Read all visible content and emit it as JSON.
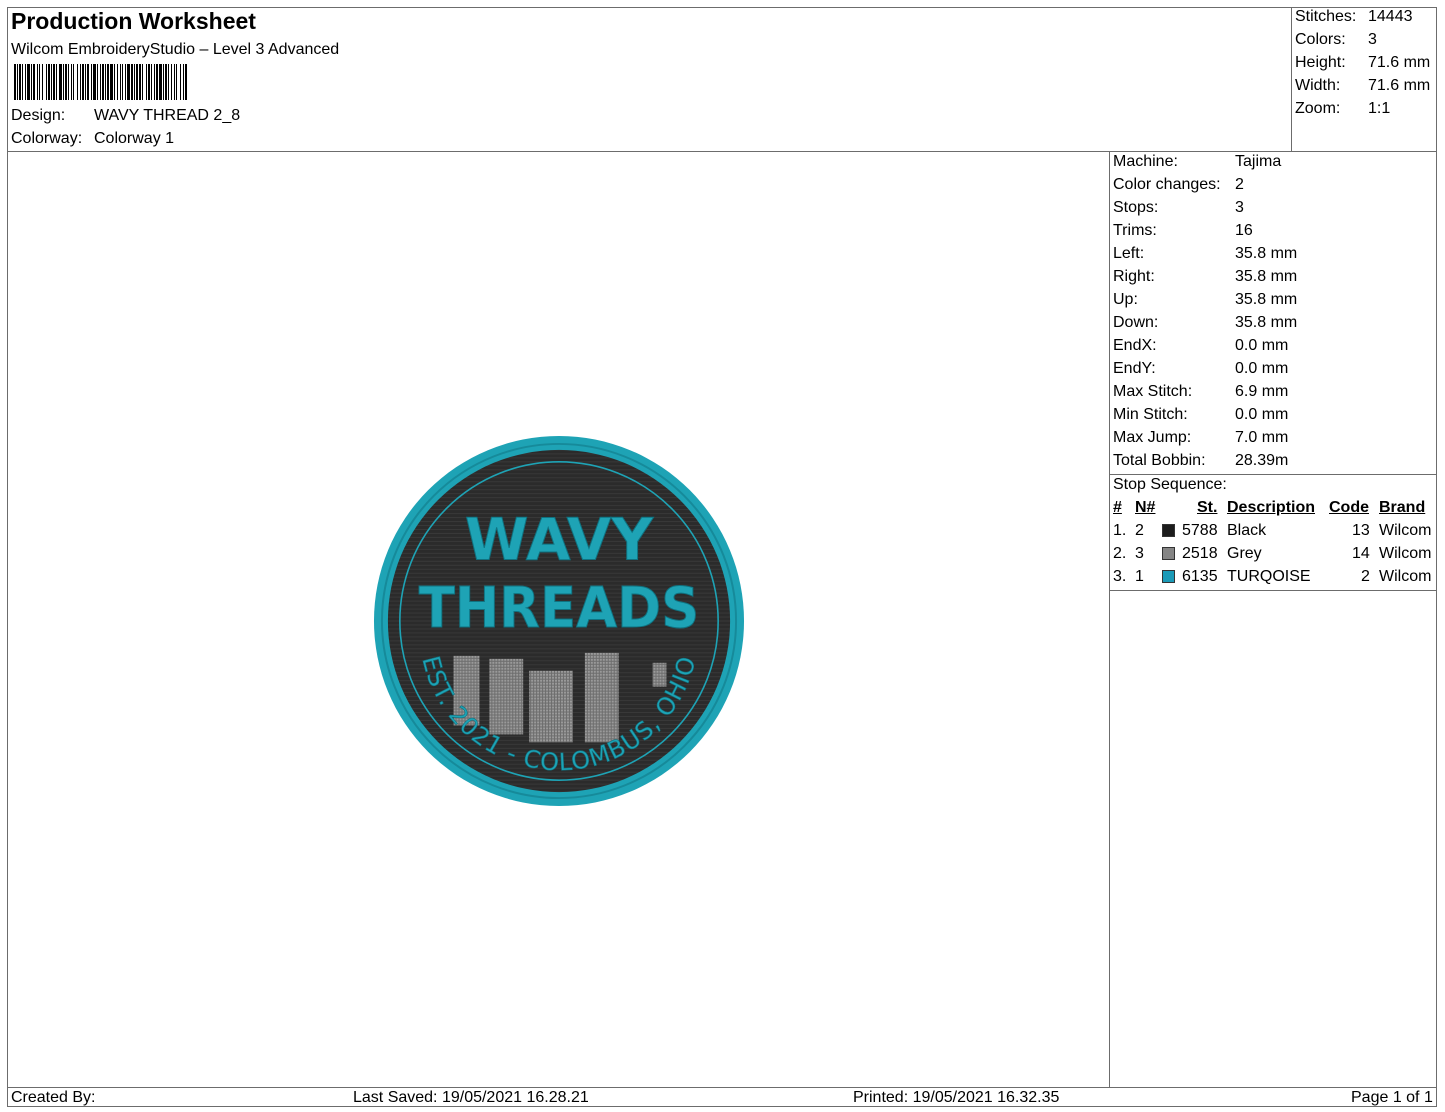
{
  "header": {
    "title": "Production Worksheet",
    "software": "Wilcom EmbroideryStudio – Level 3 Advanced",
    "design_label": "Design:",
    "design_value": "WAVY THREAD 2_8",
    "colorway_label": "Colorway:",
    "colorway_value": "Colorway 1"
  },
  "summary": {
    "stitches_label": "Stitches:",
    "stitches_value": "14443",
    "colors_label": "Colors:",
    "colors_value": "3",
    "height_label": "Height:",
    "height_value": "71.6 mm",
    "width_label": "Width:",
    "width_value": "71.6 mm",
    "zoom_label": "Zoom:",
    "zoom_value": "1:1"
  },
  "properties": [
    {
      "label": "Machine:",
      "value": "Tajima"
    },
    {
      "label": "Color changes:",
      "value": "2"
    },
    {
      "label": "Stops:",
      "value": "3"
    },
    {
      "label": "Trims:",
      "value": "16"
    },
    {
      "label": "Left:",
      "value": "35.8 mm"
    },
    {
      "label": "Right:",
      "value": "35.8 mm"
    },
    {
      "label": "Up:",
      "value": "35.8 mm"
    },
    {
      "label": "Down:",
      "value": "35.8 mm"
    },
    {
      "label": "EndX:",
      "value": "0.0 mm"
    },
    {
      "label": "EndY:",
      "value": "0.0 mm"
    },
    {
      "label": "Max Stitch:",
      "value": "6.9 mm"
    },
    {
      "label": "Min Stitch:",
      "value": "0.0 mm"
    },
    {
      "label": "Max Jump:",
      "value": "7.0 mm"
    },
    {
      "label": "Total Bobbin:",
      "value": "28.39m"
    }
  ],
  "stop_sequence": {
    "title": "Stop Sequence:",
    "headers": {
      "num": "#",
      "n": "N#",
      "st": "St.",
      "description": "Description",
      "code": "Code",
      "brand": "Brand"
    },
    "rows": [
      {
        "num": "1.",
        "n": "2",
        "color": "#1c1c1c",
        "st": "5788",
        "description": "Black",
        "code": "13",
        "brand": "Wilcom"
      },
      {
        "num": "2.",
        "n": "3",
        "color": "#858585",
        "st": "2518",
        "description": "Grey",
        "code": "14",
        "brand": "Wilcom"
      },
      {
        "num": "3.",
        "n": "1",
        "color": "#1b9ab7",
        "st": "6135",
        "description": "TURQOISE",
        "code": "2",
        "brand": "Wilcom"
      }
    ]
  },
  "patch": {
    "line1": "WAVY",
    "line2": "THREADS",
    "arc_text": "EST. 2021 - COLOMBUS, OHIO",
    "colors": {
      "turquoise": "#1ea3b5",
      "black": "#2a2a2a",
      "grey": "#8c8c8c"
    }
  },
  "footer": {
    "created_by": "Created By:",
    "last_saved": "Last Saved: 19/05/2021 16.28.21",
    "printed": "Printed: 19/05/2021 16.32.35",
    "page": "Page 1 of 1"
  }
}
